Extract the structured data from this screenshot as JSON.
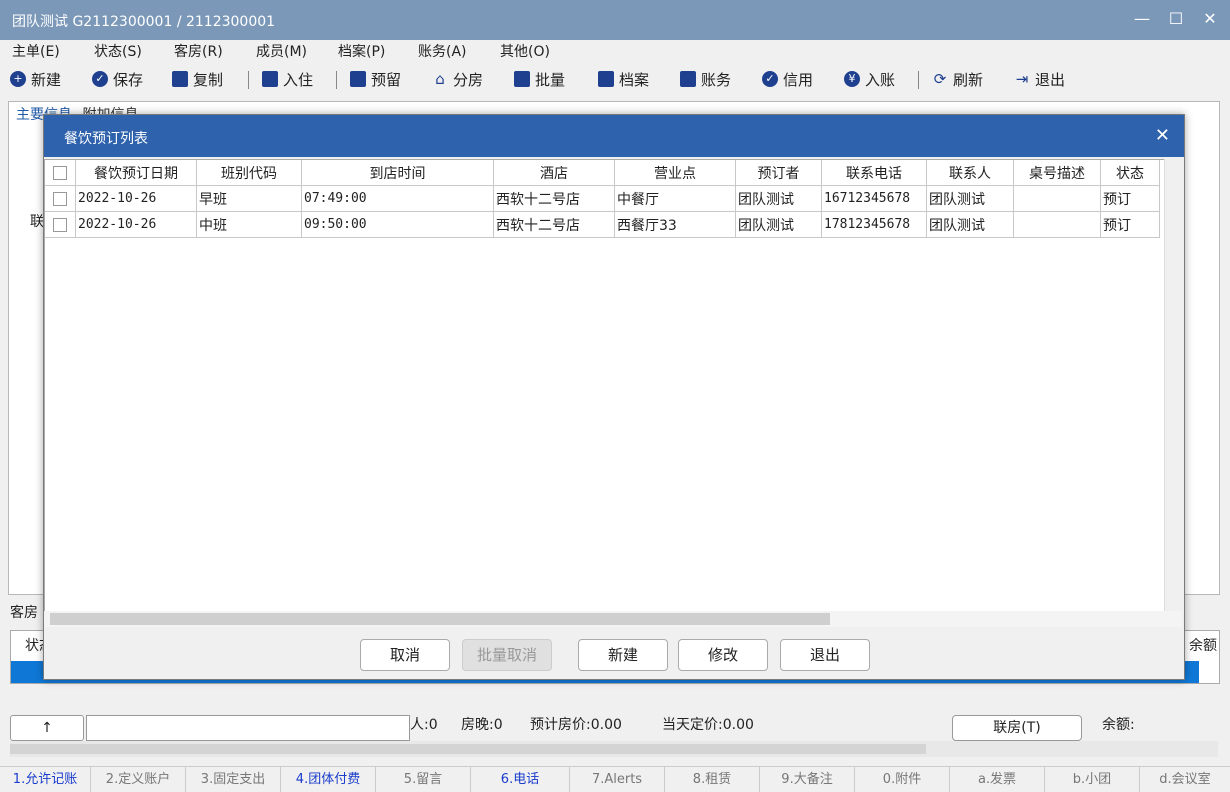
{
  "window": {
    "title": "团队测试 G2112300001 / 2112300001"
  },
  "menu": [
    "主单(E)",
    "状态(S)",
    "客房(R)",
    "成员(M)",
    "档案(P)",
    "账务(A)",
    "其他(O)"
  ],
  "toolbar": [
    "新建",
    "保存",
    "复制",
    "入住",
    "预留",
    "分房",
    "批量",
    "档案",
    "账务",
    "信用",
    "入账",
    "刷新",
    "退出"
  ],
  "main_tabs": [
    "主要信息",
    "附加信息"
  ],
  "left_label": "联",
  "lower_tab": "客房",
  "lower_header_left": "状态",
  "lower_header_right": "余额",
  "status": {
    "up": "↑",
    "people": "人:0",
    "room_nights": "房晚:0",
    "est_price": "预计房价:0.00",
    "day_price": "当天定价:0.00",
    "lianfang": "联房(T)",
    "balance": "余额:"
  },
  "bottom_tabs": [
    "1.允许记账",
    "2.定义账户",
    "3.固定支出",
    "4.团体付费",
    "5.留言",
    "6.电话",
    "7.Alerts",
    "8.租赁",
    "9.大备注",
    "0.附件",
    "a.发票",
    "b.小团",
    "d.会议室"
  ],
  "dialog": {
    "title": "餐饮预订列表",
    "columns": [
      "餐饮预订日期",
      "班别代码",
      "到店时间",
      "酒店",
      "营业点",
      "预订者",
      "联系电话",
      "联系人",
      "桌号描述",
      "状态"
    ],
    "rows": [
      [
        "2022-10-26",
        "早班",
        "07:49:00",
        "西软十二号店",
        "中餐厅",
        "团队测试",
        "16712345678",
        "团队测试",
        "",
        "预订"
      ],
      [
        "2022-10-26",
        "中班",
        "09:50:00",
        "西软十二号店",
        "西餐厅33",
        "团队测试",
        "17812345678",
        "团队测试",
        "",
        "预订"
      ]
    ],
    "buttons": {
      "cancel": "取消",
      "batch_cancel": "批量取消",
      "new": "新建",
      "modify": "修改",
      "exit": "退出"
    }
  }
}
